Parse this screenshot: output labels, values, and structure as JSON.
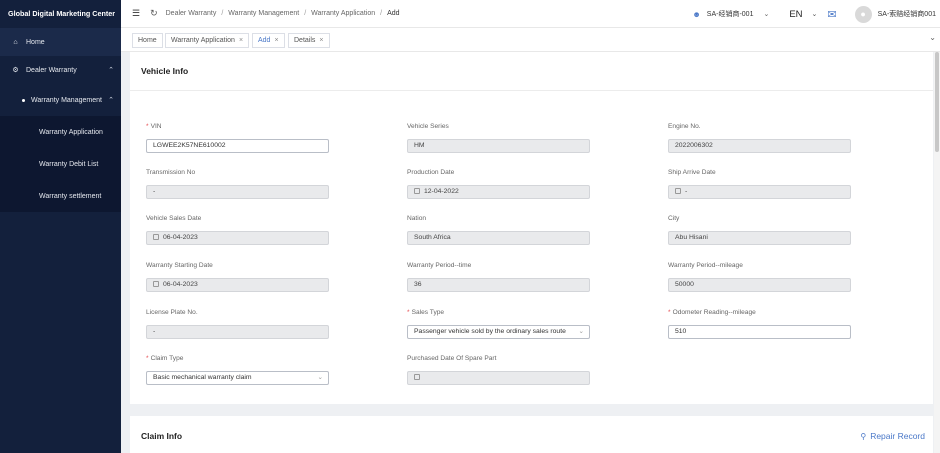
{
  "sidebar": {
    "brand": "Global Digital Marketing Center",
    "items": [
      {
        "label": "Home",
        "icon": "home-icon"
      },
      {
        "label": "Dealer Warranty",
        "icon": "gear-icon"
      },
      {
        "label": "Warranty Management"
      },
      {
        "label": "Warranty Application"
      },
      {
        "label": "Warranty Debit List"
      },
      {
        "label": "Warranty settlement"
      }
    ]
  },
  "header": {
    "breadcrumb": [
      "Dealer Warranty",
      "Warranty Management",
      "Warranty Application",
      "Add"
    ],
    "dealer": "SA-经销商-001",
    "language": "EN",
    "username": "SA-索赔经销商001"
  },
  "tabs": [
    {
      "label": "Home"
    },
    {
      "label": "Warranty Application"
    },
    {
      "label": "Add"
    },
    {
      "label": "Details"
    }
  ],
  "vehicle_info": {
    "title": "Vehicle Info",
    "fields": [
      {
        "label": "VIN",
        "value": "LGWEE2K57NE610002",
        "required": true
      },
      {
        "label": "Vehicle Series",
        "value": "HM"
      },
      {
        "label": "Engine No.",
        "value": "2022006302"
      },
      {
        "label": "Transmission No",
        "value": "-"
      },
      {
        "label": "Production Date",
        "value": "12-04-2022"
      },
      {
        "label": "Ship Arrive Date",
        "value": "-"
      },
      {
        "label": "Vehicle Sales Date",
        "value": "06-04-2023"
      },
      {
        "label": "Nation",
        "value": "South Africa"
      },
      {
        "label": "City",
        "value": "Abu Hisani"
      },
      {
        "label": "Warranty Starting Date",
        "value": "06-04-2023"
      },
      {
        "label": "Warranty Period--time",
        "value": "36"
      },
      {
        "label": "Warranty Period--mileage",
        "value": "50000"
      },
      {
        "label": "License Plate No.",
        "value": "-"
      },
      {
        "label": "Sales Type",
        "value": "Passenger vehicle sold by the ordinary sales route",
        "required": true
      },
      {
        "label": "Odometer Reading--mileage",
        "value": "510",
        "required": true
      },
      {
        "label": "Claim Type",
        "value": "Basic mechanical warranty claim",
        "required": true
      },
      {
        "label": "Purchased Date Of Spare Part",
        "value": ""
      }
    ]
  },
  "claim_info": {
    "title": "Claim Info",
    "repair_record": "Repair Record"
  },
  "colors": {
    "sidebar_bg": "#13203c",
    "accent": "#4a78c8",
    "required": "#e5484d"
  }
}
